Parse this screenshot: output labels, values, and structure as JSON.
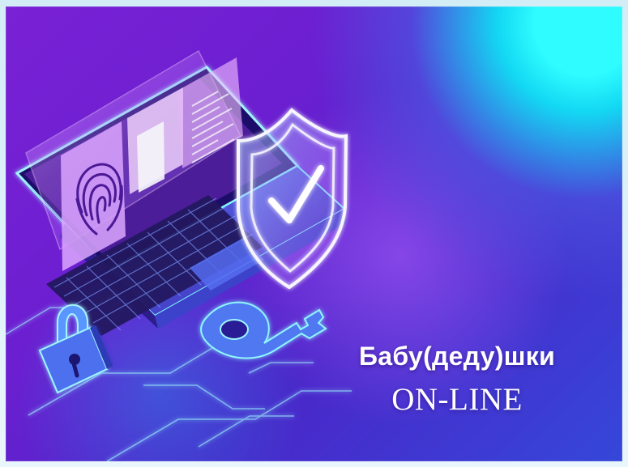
{
  "caption": {
    "line1": "Бабу(деду)шки",
    "line2": "ON-LINE"
  },
  "colors": {
    "background_primary": "#7125d1",
    "background_accent": "#25efff",
    "glow": "#8df7ff",
    "text": "#ffffff"
  },
  "icons": {
    "laptop": "laptop-icon",
    "fingerprint": "fingerprint-icon",
    "shield": "shield-check-icon",
    "lock": "padlock-icon",
    "key": "key-icon"
  }
}
